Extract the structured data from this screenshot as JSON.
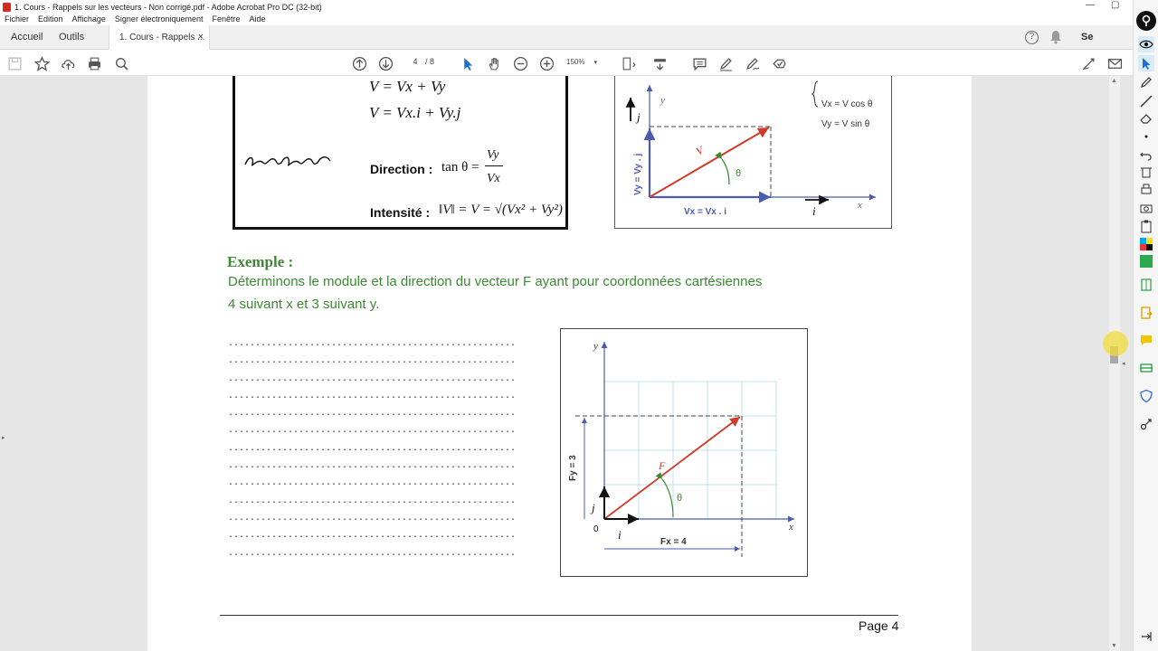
{
  "window": {
    "title": "1. Cours - Rappels sur les vecteurs - Non corrigé.pdf - Adobe Acrobat Pro DC (32-bit)"
  },
  "menu": [
    "Fichier",
    "Edition",
    "Affichage",
    "Signer électroniquement",
    "Fenêtre",
    "Aide"
  ],
  "tabs": {
    "home": "Accueil",
    "tools": "Outils",
    "document": "1. Cours - Rappels ...",
    "close": "×"
  },
  "account": {
    "signin": "Se connect"
  },
  "toolbar": {
    "page_current": "4",
    "page_total": "/ 8",
    "zoom": "150%"
  },
  "document": {
    "formulas": {
      "v_sum": "V = Vx + Vy",
      "v_comp": "V = Vx.i + Vy.j",
      "direction_label": "Direction :",
      "direction_expr": "tan θ =",
      "direction_num": "Vy",
      "direction_den": "Vx",
      "intensity_label": "Intensité :",
      "intensity_expr": "‖V‖ = V = √(Vx² + Vy²)"
    },
    "figure1": {
      "y_label": "y",
      "x_label": "x",
      "j_label": "j",
      "i_label": "i",
      "theta": "θ",
      "v_label": "V",
      "vy_label": "Vy = Vy . j",
      "vx_label": "Vx = Vx . i",
      "eq1": "Vx = V cos θ",
      "eq2": "Vy = V sin θ"
    },
    "example": {
      "title": "Exemple :",
      "line1": "Déterminons le module et la direction du vecteur F ayant pour coordonnées cartésiennes",
      "line2": "4 suivant x et 3 suivant y."
    },
    "answer_lines": [
      ".....................................................",
      ".....................................................",
      ".....................................................",
      ".....................................................",
      ".....................................................",
      ".....................................................",
      ".....................................................",
      ".....................................................",
      ".....................................................",
      ".....................................................",
      ".....................................................",
      ".....................................................",
      "....................................................."
    ],
    "figure2": {
      "y_label": "y",
      "x_label": "x",
      "origin": "0",
      "j_label": "j",
      "i_label": "i",
      "f_label": "F",
      "theta": "θ",
      "fy_label": "Fy = 3",
      "fx_label": "Fx = 4"
    },
    "page_label": "Page 4"
  },
  "colors": {
    "accent_green": "#3b8a32",
    "vector_red": "#d23a2a",
    "axis_blue": "#4a5bb0",
    "grid_cyan": "#bfe3ea"
  }
}
